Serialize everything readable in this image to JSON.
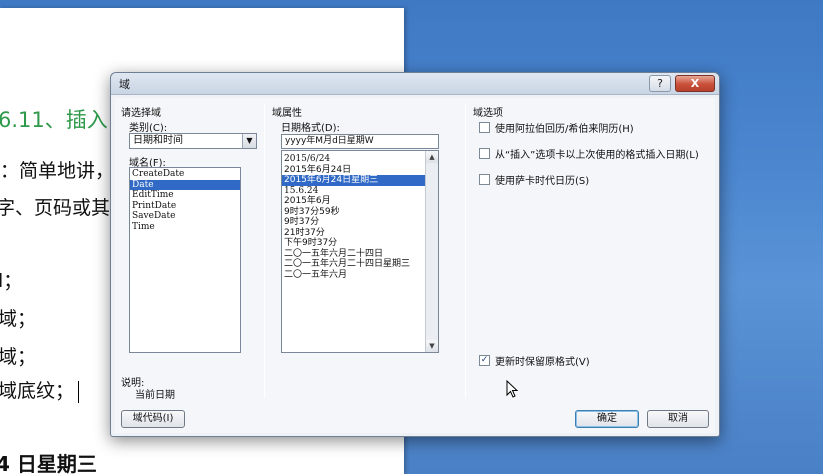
{
  "document": {
    "heading": "6.11、插入",
    "lines": [
      "：简单地讲，",
      "字、页码或其",
      "l；",
      "域；",
      "域；",
      "域底纹；",
      "4 日星期三"
    ]
  },
  "dialog": {
    "title": "域",
    "help_label": "?",
    "close_label": "X",
    "choose_field": {
      "group_label": "请选择域",
      "category_label": "类别(C):",
      "category_value": "日期和时间",
      "field_names_label": "域名(F):",
      "field_names": [
        "CreateDate",
        "Date",
        "EditTime",
        "PrintDate",
        "SaveDate",
        "Time"
      ],
      "selected_field": "Date"
    },
    "field_properties": {
      "group_label": "域属性",
      "date_format_label": "日期格式(D):",
      "date_format_value": "yyyy年M月d日星期W",
      "formats": [
        "2015/6/24",
        "2015年6月24日",
        "2015年6月24日星期三",
        "15.6.24",
        "2015年6月",
        "9时37分59秒",
        "9时37分",
        "21时37分",
        "下午9时37分",
        "二〇一五年六月二十四日",
        "二〇一五年六月二十四日星期三",
        "二〇一五年六月"
      ],
      "selected_format": "2015年6月24日星期三"
    },
    "field_options": {
      "group_label": "域选项",
      "options": [
        {
          "label": "使用阿拉伯回历/希伯来阴历(H)",
          "checked": false
        },
        {
          "label": "从“插入”选项卡以上次使用的格式插入日期(L)",
          "checked": false
        },
        {
          "label": "使用萨卡时代日历(S)",
          "checked": false
        }
      ],
      "preserve_label": "更新时保留原格式(V)",
      "preserve_checked": true
    },
    "description": {
      "label": "说明:",
      "text": "当前日期"
    },
    "buttons": {
      "field_codes": "域代码(I)",
      "ok": "确定",
      "cancel": "取消"
    }
  },
  "colors": {
    "heading_green": "#2e9a4a",
    "selection_blue": "#3169c6",
    "desktop_blue": "#4b86cf"
  }
}
